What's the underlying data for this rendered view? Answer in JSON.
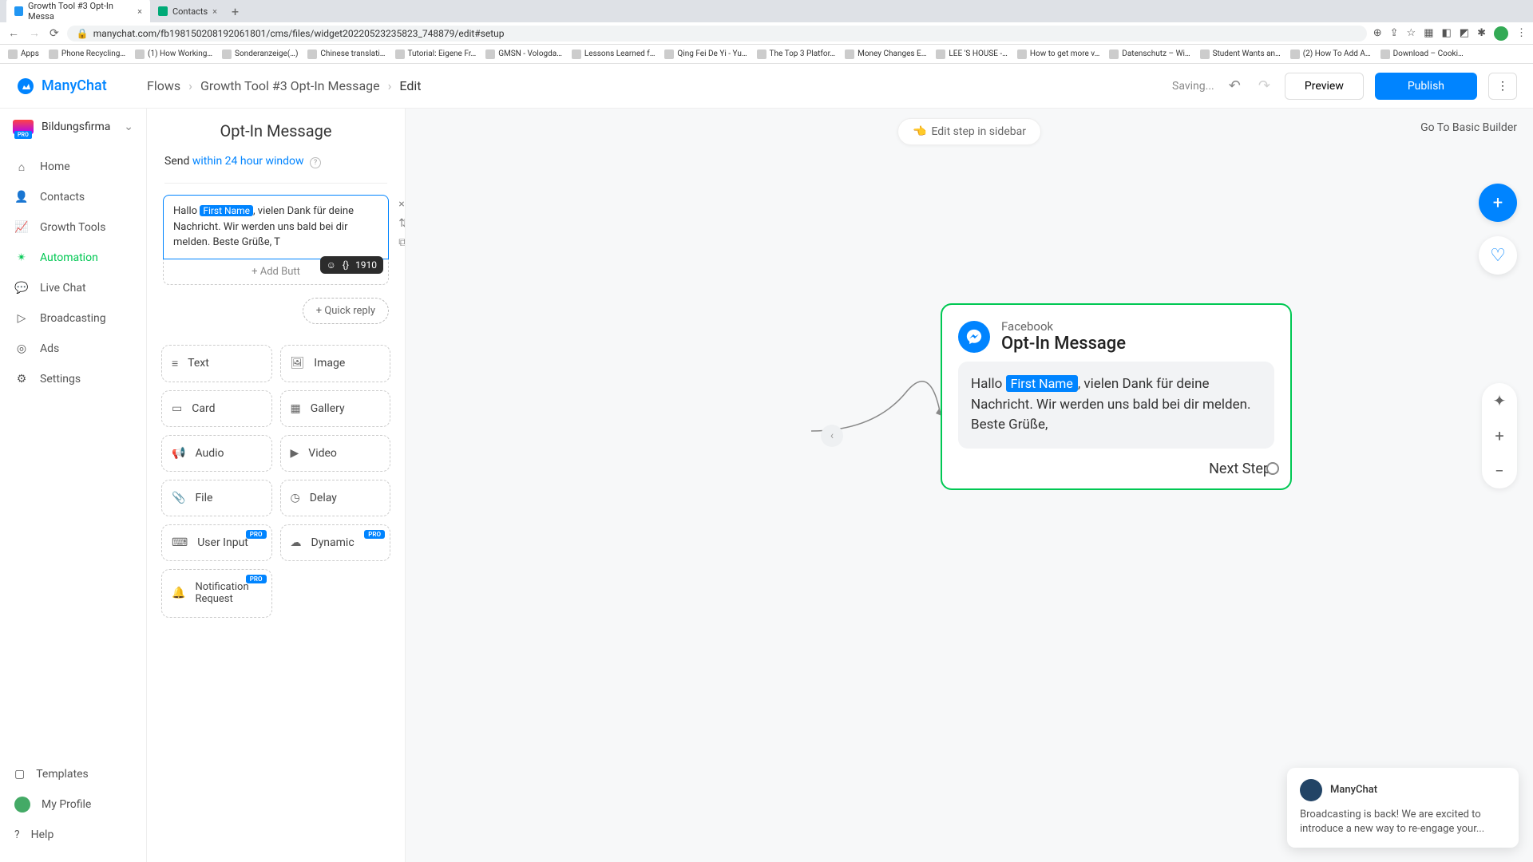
{
  "browser": {
    "tabs": [
      {
        "title": "Growth Tool #3 Opt-In Messa",
        "active": true
      },
      {
        "title": "Contacts",
        "active": false
      }
    ],
    "url": "manychat.com/fb198150208192061801/cms/files/widget20220523235823_748879/edit#setup",
    "bookmarks": [
      "Apps",
      "Phone Recycling…",
      "(1) How Working…",
      "Sonderanzeige(…)",
      "Chinese translati…",
      "Tutorial: Eigene Fr…",
      "GMSN - Vologda…",
      "Lessons Learned f…",
      "Qing Fei De Yi - Yu…",
      "The Top 3 Platfor…",
      "Money Changes E…",
      "LEE 'S HOUSE -…",
      "How to get more v…",
      "Datenschutz – Wi…",
      "Student Wants an…",
      "(2) How To Add A…",
      "Download – Cooki…"
    ]
  },
  "brand": "ManyChat",
  "breadcrumb": {
    "flows": "Flows",
    "flow_name": "Growth Tool #3 Opt-In Message",
    "page": "Edit"
  },
  "topbar": {
    "saving": "Saving...",
    "preview": "Preview",
    "publish": "Publish"
  },
  "workspace": {
    "name": "Bildungsfirma",
    "badge": "PRO"
  },
  "nav": {
    "home": "Home",
    "contacts": "Contacts",
    "growth": "Growth Tools",
    "automation": "Automation",
    "live": "Live Chat",
    "broadcasting": "Broadcasting",
    "ads": "Ads",
    "settings": "Settings",
    "templates": "Templates",
    "profile": "My Profile",
    "help": "Help"
  },
  "editor": {
    "title": "Opt-In Message",
    "send_prefix": "Send ",
    "send_link": "within 24 hour window",
    "msg_before": "Hallo ",
    "msg_var": "First Name",
    "msg_after": ", vielen Dank für deine Nachricht. Wir werden uns bald bei dir melden. Beste Grüße, T",
    "add_button": "+ Add Butt",
    "char_count": "1910",
    "quick_reply": "+ Quick reply",
    "blocks": {
      "text": "Text",
      "image": "Image",
      "card": "Card",
      "gallery": "Gallery",
      "audio": "Audio",
      "video": "Video",
      "file": "File",
      "delay": "Delay",
      "userinput": "User Input",
      "dynamic": "Dynamic",
      "notif": "Notification Request"
    },
    "pro": "PRO"
  },
  "canvas": {
    "edit_sidebar": "Edit step in sidebar",
    "basic": "Go To Basic Builder",
    "node_channel": "Facebook",
    "node_title": "Opt-In Message",
    "node_msg_before": "Hallo ",
    "node_msg_var": "First Name",
    "node_msg_after": ", vielen Dank für deine Nachricht. Wir werden uns bald bei dir melden. Beste Grüße,",
    "next_step": "Next Step"
  },
  "toast": {
    "name": "ManyChat",
    "body": "Broadcasting is back! We are excited to introduce a new way to re-engage your..."
  }
}
